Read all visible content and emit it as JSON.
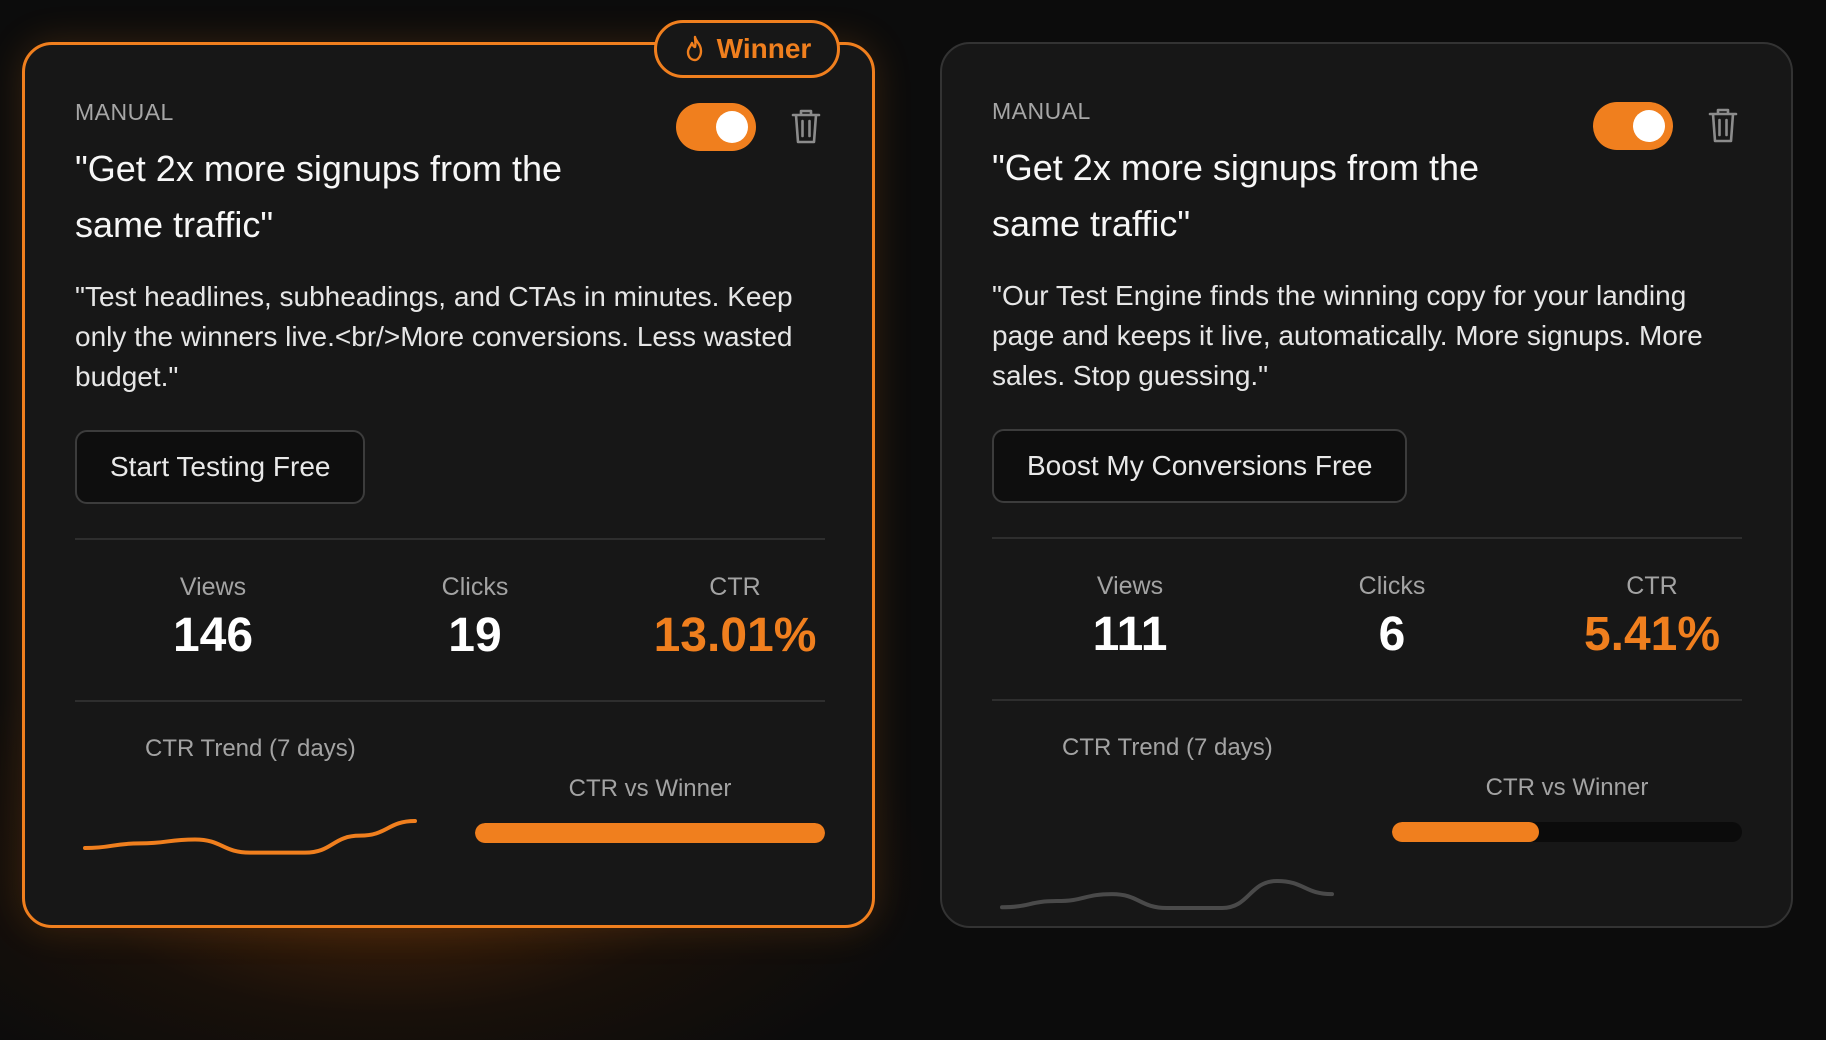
{
  "accent_color": "#f07f1e",
  "winner_badge": {
    "label": "Winner",
    "icon": "flame-icon"
  },
  "cards": [
    {
      "kind": "MANUAL",
      "headline": "\"Get 2x more signups from the same traffic\"",
      "description": "\"Test headlines, subheadings, and CTAs in minutes. Keep only the winners live.<br/>More conversions. Less wasted budget.\"",
      "cta_label": "Start Testing Free",
      "enabled": true,
      "is_winner": true,
      "stats": {
        "views_label": "Views",
        "views": "146",
        "clicks_label": "Clicks",
        "clicks": "19",
        "ctr_label": "CTR",
        "ctr": "13.01%"
      },
      "trend_label": "CTR Trend (7 days)",
      "trend": [
        12.0,
        12.6,
        13.1,
        11.4,
        11.4,
        13.6,
        15.5
      ],
      "vs_label": "CTR vs Winner",
      "vs_winner_ratio": 1.0
    },
    {
      "kind": "MANUAL",
      "headline": "\"Get 2x more signups from the same traffic\"",
      "description": "\"Our Test Engine finds the winning copy for your landing page and keeps it live, automatically. More signups. More sales. Stop guessing.\"",
      "cta_label": "Boost My Conversions Free",
      "enabled": true,
      "is_winner": false,
      "stats": {
        "views_label": "Views",
        "views": "111",
        "clicks_label": "Clicks",
        "clicks": "6",
        "ctr_label": "CTR",
        "ctr": "5.41%"
      },
      "trend_label": "CTR Trend (7 days)",
      "trend": [
        4.2,
        5.0,
        5.9,
        4.1,
        4.1,
        7.6,
        5.9
      ],
      "vs_label": "CTR vs Winner",
      "vs_winner_ratio": 0.42
    }
  ]
}
